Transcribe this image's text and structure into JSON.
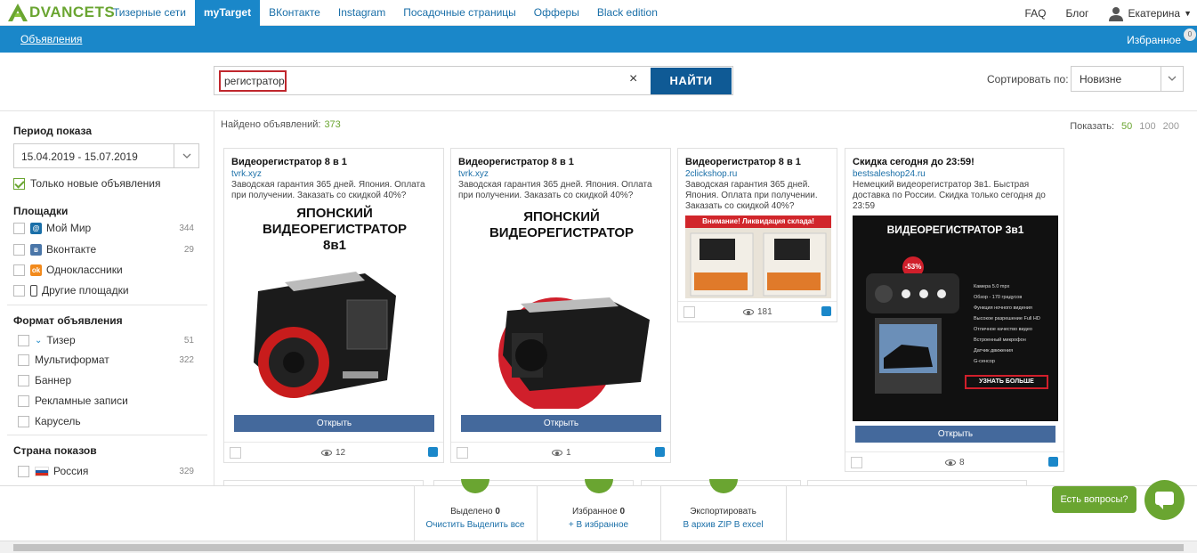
{
  "brand": {
    "logo_text": "DVANCETS",
    "logo_letter": "A",
    "logo_color": "#6aa531"
  },
  "topnav": [
    {
      "label": "Тизерные сети"
    },
    {
      "label": "myTarget",
      "active": true
    },
    {
      "label": "ВКонтакте"
    },
    {
      "label": "Instagram"
    },
    {
      "label": "Посадочные страницы"
    },
    {
      "label": "Офферы"
    },
    {
      "label": "Black edition"
    }
  ],
  "topright": {
    "faq": "FAQ",
    "blog": "Блог",
    "user": "Екатерина"
  },
  "subnav": {
    "ads": "Объявления",
    "favorites": "Избранное",
    "favorites_count": "0"
  },
  "search": {
    "value": "регистратор",
    "button": "НАЙТИ",
    "clear_icon": "×"
  },
  "sort": {
    "label": "Сортировать по:",
    "value": "Новизне"
  },
  "sidebar": {
    "period_title": "Период показа",
    "period_value": "15.04.2019 - 15.07.2019",
    "only_new": "Только новые объявления",
    "platforms_title": "Площадки",
    "platforms": [
      {
        "label": "Мой Мир",
        "count": "344",
        "icon": "mail-icon",
        "color": "#1a6fa8"
      },
      {
        "label": "Вконтакте",
        "count": "29",
        "icon": "vk-icon",
        "color": "#4a76a8"
      },
      {
        "label": "Одноклассники",
        "count": "",
        "icon": "ok-icon",
        "color": "#f28a1c"
      },
      {
        "label": "Другие площадки",
        "count": "",
        "icon": "phone-icon",
        "color": "#444"
      }
    ],
    "format_title": "Формат объявления",
    "formats": [
      {
        "label": "Тизер",
        "count": "51"
      },
      {
        "label": "Мультиформат",
        "count": "322"
      },
      {
        "label": "Баннер",
        "count": ""
      },
      {
        "label": "Рекламные записи",
        "count": ""
      },
      {
        "label": "Карусель",
        "count": ""
      }
    ],
    "country_title": "Страна показов",
    "countries": [
      {
        "label": "Россия",
        "count": "329"
      }
    ]
  },
  "results": {
    "found_label": "Найдено объявлений:",
    "found_count": "373",
    "show_label": "Показать:",
    "show_options": [
      "50",
      "100",
      "200"
    ]
  },
  "cards": [
    {
      "title": "Видеорегистратор 8 в 1",
      "domain": "tvrk.xyz",
      "desc": [
        "Заводская гарантия 365 дней. Япония. Оплата",
        "при получении. Заказать со скидкой 40%?"
      ],
      "img_lines": [
        "ЯПОНСКИЙ",
        "ВИДЕОРЕГИСТРАТОР",
        "8в1"
      ],
      "open": "Открыть",
      "views": "12"
    },
    {
      "title": "Видеорегистратор 8 в 1",
      "domain": "tvrk.xyz",
      "desc": [
        "Заводская гарантия 365 дней. Япония. Оплата",
        "при получении. Заказать со скидкой 40%?"
      ],
      "img_lines": [
        "ЯПОНСКИЙ",
        "ВИДЕОРЕГИСТРАТОР"
      ],
      "open": "Открыть",
      "views": "1"
    },
    {
      "title": "Видеорегистратор 8 в 1",
      "domain": "2clickshop.ru",
      "desc": [
        "Заводская гарантия 365 дней.",
        "Япония. Оплата при получении.",
        "Заказать со скидкой 40%?"
      ],
      "img_banner": "Внимание! Ликвидация склада!",
      "views": "181"
    },
    {
      "title": "Скидка сегодня до 23:59!",
      "domain": "bestsaleshop24.ru",
      "desc": [
        "Немецкий видеорегистратор 3в1. Быстрая",
        "доставка по России. Скидка только сегодня до",
        "23:59"
      ],
      "img_title": "ВИДЕОРЕГИСТРАТОР 3в1",
      "img_badge": "-53%",
      "img_features": [
        "Камера 5.0 mpx",
        "Обзор - 170 градусов",
        "Функция ночного видения",
        "Высокое разрешение Full HD",
        "Отличное качество видео",
        "Встроенный микрофон",
        "Датчик движения",
        "G-сенсор"
      ],
      "img_button": "УЗНАТЬ БОЛЬШЕ",
      "open": "Открыть",
      "views": "8"
    }
  ],
  "bottom": [
    {
      "l1a": "Выделено",
      "l1b": "0",
      "l2": "Очистить Выделить все"
    },
    {
      "l1a": "Избранное",
      "l1b": "0",
      "l2": "+ В избранное"
    },
    {
      "l1a": "Экспортировать",
      "l1b": "",
      "l2": "В архив ZIP В excel"
    }
  ],
  "help": {
    "ask": "Есть вопросы?"
  }
}
